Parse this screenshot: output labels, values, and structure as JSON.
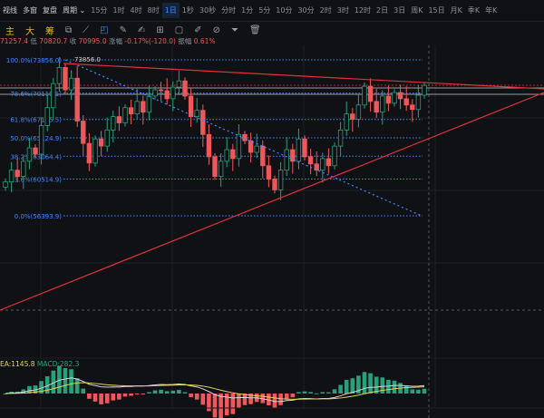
{
  "toolbar": {
    "items": [
      "视线",
      "多窗",
      "复盘",
      "周期 ⌄",
      "15分",
      "1时",
      "4时",
      "8时",
      "1日",
      "1秒",
      "30秒",
      "分时",
      "1分",
      "5分",
      "10分",
      "30分",
      "2时",
      "3时",
      "12时",
      "2日",
      "3日",
      "周K",
      "15日",
      "月K",
      "季K",
      "年K"
    ],
    "active": "1日"
  },
  "tools": {
    "labels": [
      "主",
      "大",
      "筹"
    ]
  },
  "info": {
    "high": "71257.4",
    "low_label": "低",
    "low": "70820.7",
    "close_label": "收",
    "close": "70995.0",
    "change_label": "涨幅",
    "change": "-0.17%(-120.0)",
    "amp_label": "振幅",
    "amp": "0.61%"
  },
  "fib": [
    {
      "label": "100.0%(73856.0)",
      "price": 73856.0
    },
    {
      "label": "78.6%(70119.1)",
      "price": 70119.1
    },
    {
      "label": "61.8%(67185.5)",
      "price": 67185.5
    },
    {
      "label": "50.0%(65124.9)",
      "price": 65124.9
    },
    {
      "label": "38.2%(63064.4)",
      "price": 63064.4
    },
    {
      "label": "23.6%(60514.9)",
      "price": 60514.9
    },
    {
      "label": "0.0%(56393.9)",
      "price": 56393.9
    }
  ],
  "peak_label": "73856.0",
  "macd": {
    "dea": "EA:1145.8",
    "macd": "MACD:282.3"
  },
  "colors": {
    "up": "#26a17a",
    "down": "#f0575a",
    "fib": "#3d8bff",
    "trend": "#e0313a"
  },
  "closes": [
    60200,
    61500,
    60800,
    62500,
    64000,
    63300,
    66500,
    68500,
    71200,
    73000,
    70500,
    71800,
    67000,
    64500,
    62300,
    65000,
    64200,
    66000,
    67500,
    66800,
    68500,
    67800,
    69200,
    68000,
    69800,
    70500,
    70400,
    69500,
    70800,
    71500,
    69800,
    67500,
    68200,
    65500,
    63000,
    60800,
    62500,
    63800,
    62800,
    65500,
    64800,
    63500,
    64200,
    62000,
    60500,
    59300,
    61500,
    63800,
    62500,
    65000,
    63000,
    62200,
    61500,
    62800,
    62000,
    64200,
    66000,
    67800,
    67200,
    68800,
    70900,
    69200,
    68000,
    69800,
    69000,
    70200,
    69500,
    68800,
    68300,
    69900,
    71000
  ]
}
